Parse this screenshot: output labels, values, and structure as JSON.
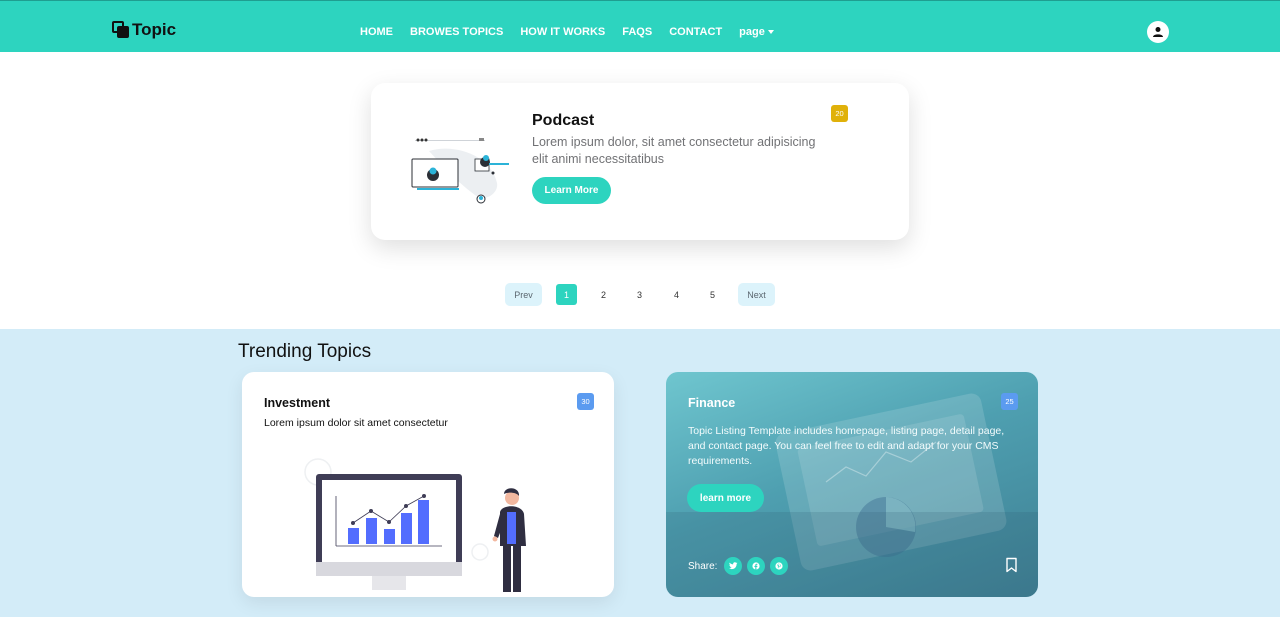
{
  "navbar": {
    "brand": "Topic",
    "links": [
      {
        "label": "HOME"
      },
      {
        "label": "BROWES TOPICS"
      },
      {
        "label": "HOW IT WORKS"
      },
      {
        "label": "FAQS"
      },
      {
        "label": "CONTACT"
      },
      {
        "label": "page"
      }
    ],
    "avatar_icon": "user-icon"
  },
  "podcast_card": {
    "title": "Podcast",
    "description": "Lorem ipsum dolor, sit amet consectetur adipisicing elit animi necessitatibus",
    "button": "Learn More",
    "badge": "20",
    "badge_color": "#e0b10a"
  },
  "pagination": {
    "prev": "Prev",
    "pages": [
      "1",
      "2",
      "3",
      "4",
      "5"
    ],
    "active_page": "1",
    "next": "Next"
  },
  "trending": {
    "title": "Trending Topics",
    "cards": [
      {
        "title": "Investment",
        "description": "Lorem ipsum dolor sit amet consectetur",
        "badge": "30"
      },
      {
        "title": "Finance",
        "description": "Topic Listing Template includes homepage, listing page, detail page, and contact page. You can feel free to edit and adapt for your CMS requirements.",
        "badge": "25",
        "button": "learn more",
        "share_label": "Share:",
        "share_icons": [
          "twitter-icon",
          "facebook-icon",
          "pinterest-icon"
        ]
      }
    ]
  },
  "colors": {
    "accent": "#2dd4bf",
    "section_bg": "#d3ecf8",
    "badge_blue": "#5b9bf0"
  }
}
